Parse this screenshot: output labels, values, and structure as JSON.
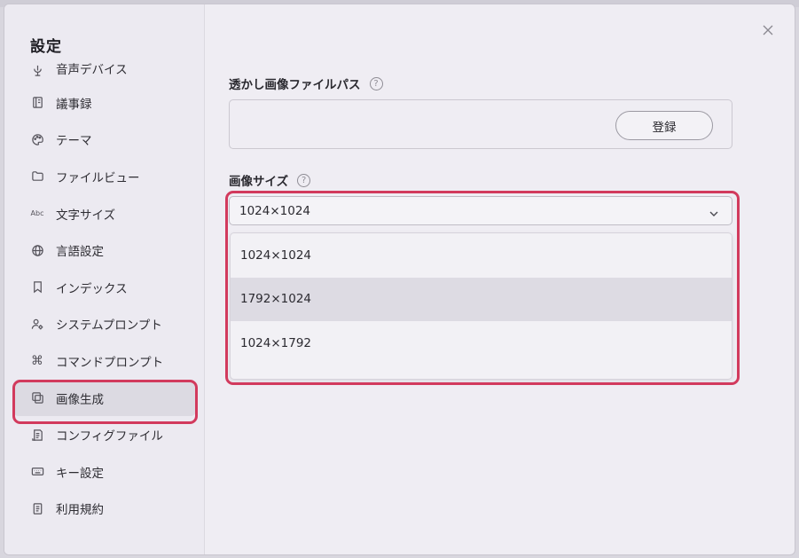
{
  "sidebar": {
    "title": "設定",
    "items": [
      {
        "label": "音声デバイス",
        "icon": "microphone-icon"
      },
      {
        "label": "議事録",
        "icon": "notebook-icon"
      },
      {
        "label": "テーマ",
        "icon": "palette-icon"
      },
      {
        "label": "ファイルビュー",
        "icon": "folder-icon"
      },
      {
        "label": "文字サイズ",
        "icon": "text-size-icon",
        "glyph": "Abc"
      },
      {
        "label": "言語設定",
        "icon": "globe-icon"
      },
      {
        "label": "インデックス",
        "icon": "bookmark-icon"
      },
      {
        "label": "システムプロンプト",
        "icon": "user-gear-icon"
      },
      {
        "label": "コマンドプロンプト",
        "icon": "command-icon",
        "glyph": "⌘"
      },
      {
        "label": "画像生成",
        "icon": "image-stack-icon",
        "active": true
      },
      {
        "label": "コンフィグファイル",
        "icon": "config-file-icon"
      },
      {
        "label": "キー設定",
        "icon": "keyboard-icon"
      },
      {
        "label": "利用規約",
        "icon": "document-icon"
      }
    ]
  },
  "main": {
    "watermark": {
      "label": "透かし画像ファイルパス",
      "help": "?",
      "register_label": "登録"
    },
    "image_size": {
      "label": "画像サイズ",
      "help": "?",
      "selected": "1024×1024",
      "options": [
        "1024×1024",
        "1792×1024",
        "1024×1792"
      ],
      "hovered_index": 1
    }
  },
  "colors": {
    "highlight": "#d23a5d",
    "background": "#efedf3",
    "active_item": "#dcdae2"
  }
}
